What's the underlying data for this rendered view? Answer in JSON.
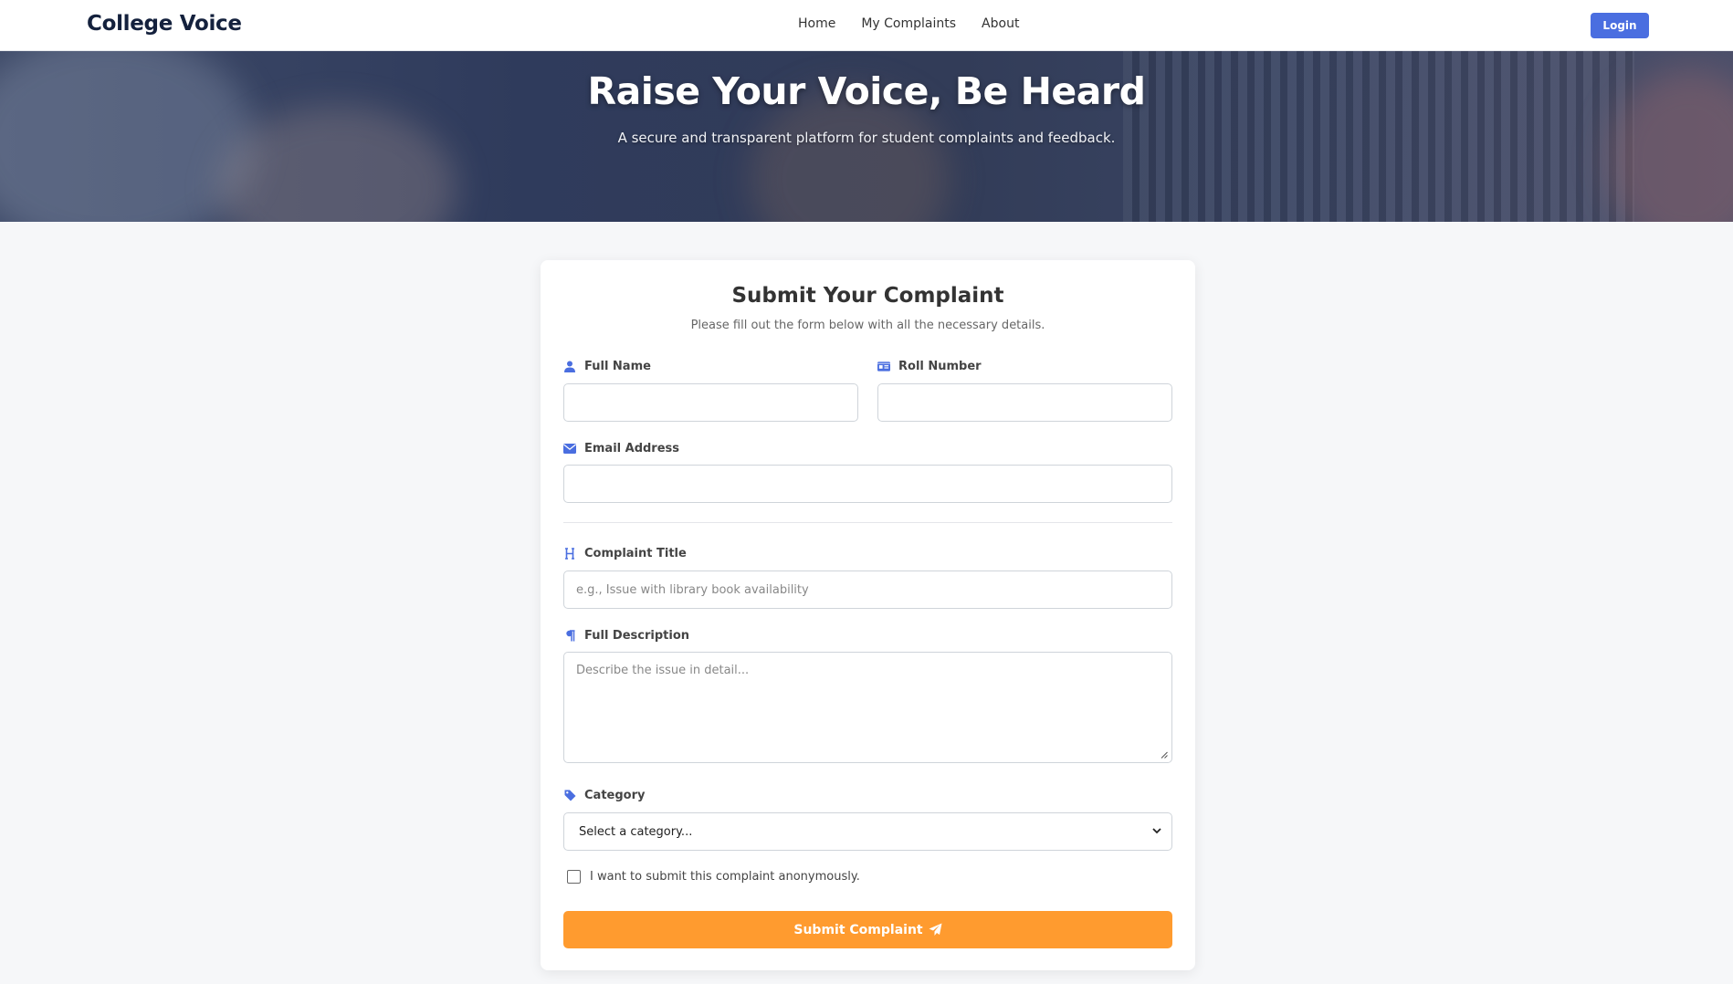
{
  "navbar": {
    "brand": "College Voice",
    "links": [
      "Home",
      "My Complaints",
      "About"
    ],
    "login_label": "Login"
  },
  "hero": {
    "title": "Raise Your Voice, Be Heard",
    "subtitle": "A secure and transparent platform for student complaints and feedback."
  },
  "form": {
    "title": "Submit Your Complaint",
    "subtitle": "Please fill out the form below with all the necessary details.",
    "full_name": {
      "label": "Full Name",
      "value": "",
      "icon": "user-icon"
    },
    "roll_number": {
      "label": "Roll Number",
      "value": "",
      "icon": "id-card-icon"
    },
    "email": {
      "label": "Email Address",
      "value": "",
      "icon": "envelope-icon"
    },
    "complaint_title": {
      "label": "Complaint Title",
      "placeholder": "e.g., Issue with library book availability",
      "icon": "heading-icon"
    },
    "description": {
      "label": "Full Description",
      "placeholder": "Describe the issue in detail...",
      "icon": "paragraph-icon"
    },
    "category": {
      "label": "Category",
      "selected": "Select a category...",
      "icon": "tag-icon"
    },
    "anonymous_label": "I want to submit this complaint anonymously.",
    "anonymous_checked": false,
    "submit_label": "Submit Complaint",
    "submit_icon": "paper-plane-icon"
  },
  "colors": {
    "brand": "#14213d",
    "accent": "#4a6ee0",
    "submit": "#ff9b2f",
    "icon": "#4a6ee0"
  }
}
